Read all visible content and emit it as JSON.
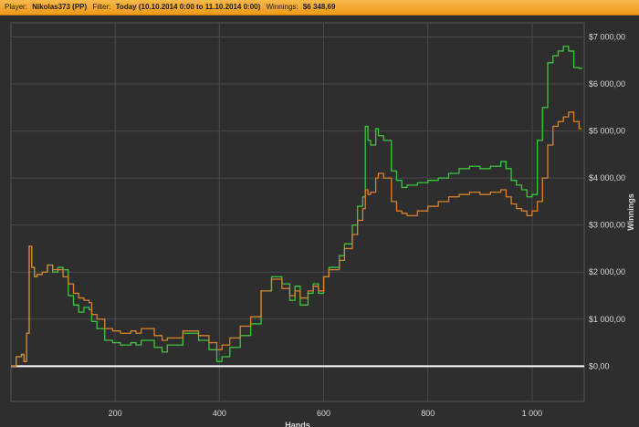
{
  "header": {
    "player_label": "Player:",
    "player_value": "Nikolas373 (PP)",
    "filter_label": "Filter:",
    "filter_value": "Today (10.10.2014 0:00 to 11.10.2014 0:00)",
    "winnings_label": "Winnings:",
    "winnings_value": "$6 348,69"
  },
  "chart_data": {
    "type": "line",
    "xlabel": "Hands",
    "ylabel": "Winnings",
    "xlim": [
      0,
      1100
    ],
    "ylim": [
      -750,
      7300
    ],
    "x_ticks": [
      200,
      400,
      600,
      800,
      1000
    ],
    "x_tick_labels": [
      "200",
      "400",
      "600",
      "800",
      "1 000"
    ],
    "y_ticks": [
      0,
      1000,
      2000,
      3000,
      4000,
      5000,
      6000,
      7000
    ],
    "y_tick_labels": [
      "$0,00",
      "$1 000,00",
      "$2 000,00",
      "$3 000,00",
      "$4 000,00",
      "$5 000,00",
      "$6 000,00",
      "$7 000,00"
    ],
    "grid": true,
    "colors": {
      "background": "#2e2e2e",
      "grid": "#4a4a4a",
      "zero_line": "#ffffff",
      "green": "#3fc43f",
      "orange": "#d9822b"
    },
    "series": [
      {
        "color": "#3fc43f",
        "x": [
          0,
          10,
          20,
          25,
          30,
          35,
          40,
          45,
          50,
          60,
          70,
          80,
          90,
          100,
          110,
          120,
          130,
          140,
          150,
          155,
          165,
          180,
          195,
          210,
          230,
          240,
          250,
          275,
          290,
          300,
          330,
          360,
          380,
          395,
          405,
          420,
          440,
          460,
          480,
          500,
          520,
          535,
          545,
          555,
          570,
          580,
          590,
          600,
          610,
          630,
          640,
          655,
          665,
          675,
          680,
          685,
          690,
          700,
          705,
          715,
          730,
          740,
          750,
          760,
          780,
          800,
          820,
          840,
          860,
          880,
          900,
          920,
          940,
          950,
          960,
          970,
          980,
          990,
          1000,
          1010,
          1020,
          1030,
          1040,
          1050,
          1060,
          1070,
          1080,
          1090,
          1095
        ],
        "values": [
          0,
          200,
          250,
          100,
          700,
          2550,
          2100,
          1900,
          1950,
          2000,
          2150,
          2000,
          2100,
          2050,
          1500,
          1300,
          1150,
          1250,
          1200,
          950,
          800,
          550,
          500,
          450,
          500,
          450,
          550,
          400,
          300,
          450,
          700,
          550,
          350,
          100,
          200,
          400,
          650,
          900,
          1600,
          1900,
          1750,
          1400,
          1700,
          1300,
          1550,
          1750,
          1550,
          1900,
          2100,
          2350,
          2600,
          3000,
          3400,
          3600,
          5100,
          4800,
          4700,
          5050,
          4900,
          4800,
          4150,
          3950,
          3800,
          3850,
          3900,
          3950,
          4000,
          4100,
          4200,
          4250,
          4200,
          4250,
          4350,
          4200,
          3950,
          3850,
          3750,
          3600,
          3650,
          4800,
          5500,
          6450,
          6600,
          6700,
          6800,
          6700,
          6350,
          6330,
          6349
        ]
      },
      {
        "color": "#d9822b",
        "x": [
          0,
          10,
          20,
          25,
          30,
          35,
          40,
          45,
          50,
          60,
          70,
          80,
          90,
          100,
          110,
          120,
          130,
          140,
          150,
          155,
          165,
          180,
          195,
          210,
          230,
          240,
          250,
          275,
          290,
          300,
          330,
          360,
          380,
          395,
          405,
          420,
          440,
          460,
          480,
          500,
          520,
          535,
          545,
          555,
          570,
          580,
          590,
          600,
          610,
          630,
          640,
          655,
          665,
          675,
          680,
          685,
          690,
          700,
          705,
          715,
          730,
          740,
          750,
          760,
          780,
          800,
          820,
          840,
          860,
          880,
          900,
          920,
          940,
          950,
          960,
          970,
          980,
          990,
          1000,
          1010,
          1020,
          1030,
          1040,
          1050,
          1060,
          1070,
          1080,
          1090,
          1095
        ],
        "values": [
          0,
          200,
          250,
          100,
          700,
          2550,
          2100,
          1900,
          1950,
          2000,
          2150,
          2050,
          2050,
          1900,
          1750,
          1550,
          1450,
          1400,
          1350,
          1100,
          1000,
          800,
          750,
          700,
          750,
          700,
          800,
          650,
          550,
          600,
          750,
          650,
          500,
          350,
          450,
          600,
          850,
          1050,
          1600,
          1850,
          1650,
          1500,
          1600,
          1450,
          1600,
          1700,
          1600,
          1900,
          2050,
          2250,
          2500,
          2800,
          3100,
          3350,
          3750,
          3650,
          3700,
          4000,
          4100,
          4000,
          3500,
          3300,
          3250,
          3200,
          3300,
          3400,
          3500,
          3600,
          3650,
          3700,
          3650,
          3700,
          3750,
          3600,
          3450,
          3350,
          3300,
          3200,
          3300,
          3500,
          4000,
          4700,
          5100,
          5200,
          5300,
          5400,
          5200,
          5050,
          5050
        ]
      }
    ]
  }
}
